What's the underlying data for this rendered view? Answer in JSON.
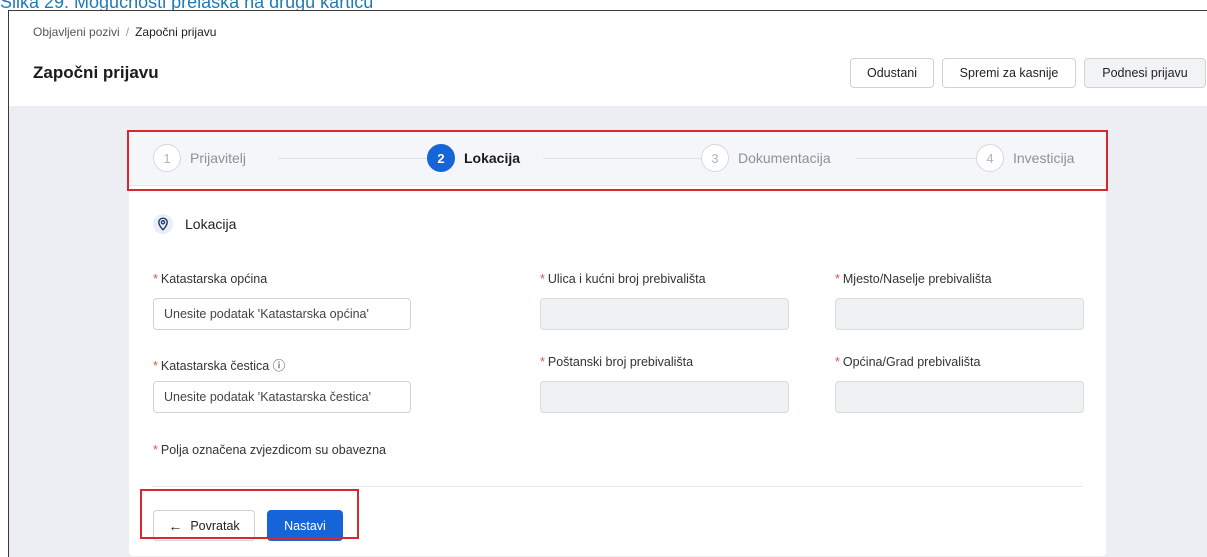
{
  "caption": "Slika 29. Mogućnosti prelaska na drugu karticu",
  "breadcrumb": {
    "parent": "Objavljeni pozivi",
    "separator": "/",
    "current": "Započni prijavu"
  },
  "page_title": "Započni prijavu",
  "header_buttons": {
    "cancel": "Odustani",
    "save_later": "Spremi za kasnije",
    "submit": "Podnesi prijavu"
  },
  "steps": [
    {
      "number": "1",
      "label": "Prijavitelj",
      "active": false
    },
    {
      "number": "2",
      "label": "Lokacija",
      "active": true
    },
    {
      "number": "3",
      "label": "Dokumentacija",
      "active": false
    },
    {
      "number": "4",
      "label": "Investicija",
      "active": false
    }
  ],
  "section": {
    "icon": "location-pin-icon",
    "title": "Lokacija"
  },
  "fields": {
    "katastarska_opcina": {
      "label": "Katastarska općina",
      "required_mark": "*",
      "placeholder": "Unesite podatak 'Katastarska općina'",
      "value": ""
    },
    "ulica": {
      "label": "Ulica i kućni broj prebivališta",
      "required_mark": "*",
      "value": ""
    },
    "mjesto": {
      "label": "Mjesto/Naselje prebivališta",
      "required_mark": "*",
      "value": ""
    },
    "katastarska_cestica": {
      "label": "Katastarska čestica",
      "required_mark": "*",
      "info_icon": "ⓘ",
      "placeholder": "Unesite podatak 'Katastarska čestica'",
      "value": ""
    },
    "postanski_broj": {
      "label": "Poštanski broj prebivališta",
      "required_mark": "*",
      "value": ""
    },
    "opcina_grad": {
      "label": "Općina/Grad prebivališta",
      "required_mark": "*",
      "value": ""
    }
  },
  "required_note": {
    "mark": "*",
    "text": "Polja označena zvjezdicom su obavezna"
  },
  "footer_buttons": {
    "back_arrow": "←",
    "back": "Povratak",
    "next": "Nastavi"
  },
  "colors": {
    "accent": "#1565d8",
    "highlight": "#d9272e",
    "required": "#e0534a",
    "caption": "#1f7ab8"
  }
}
